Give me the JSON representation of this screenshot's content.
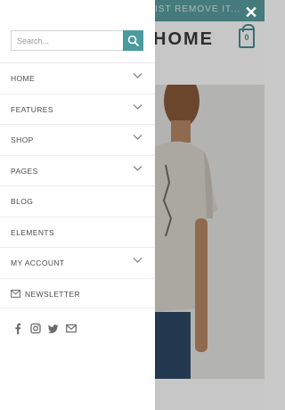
{
  "background": {
    "topbar_text": "IST REMOVE IT...",
    "logo_text": "HOME",
    "cart_count": "0"
  },
  "menu": {
    "search": {
      "placeholder": "Search...",
      "value": ""
    },
    "items": [
      {
        "label": "HOME",
        "has_children": true
      },
      {
        "label": "FEATURES",
        "has_children": true
      },
      {
        "label": "SHOP",
        "has_children": true
      },
      {
        "label": "PAGES",
        "has_children": true
      },
      {
        "label": "BLOG",
        "has_children": false
      },
      {
        "label": "ELEMENTS",
        "has_children": false
      },
      {
        "label": "MY ACCOUNT",
        "has_children": true
      },
      {
        "label": "NEWSLETTER",
        "has_children": false,
        "icon": "envelope-icon"
      }
    ],
    "social": [
      "facebook-icon",
      "instagram-icon",
      "twitter-icon",
      "email-icon"
    ]
  },
  "colors": {
    "accent": "#4b9a9d",
    "topbar": "#5a9ea0",
    "menu_text": "#4a4a4a",
    "divider": "#ececec"
  }
}
